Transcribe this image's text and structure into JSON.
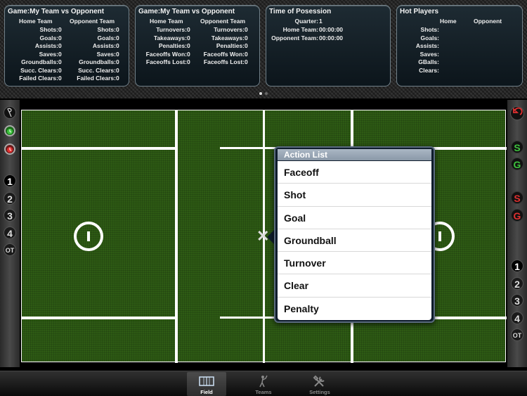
{
  "panels": {
    "game_stats": {
      "title": "Game:My Team vs Opponent",
      "home_header": "Home Team",
      "opp_header": "Opponent Team",
      "rows": [
        {
          "label": "Shots:",
          "home": "0",
          "opp": "0"
        },
        {
          "label": "Goals:",
          "home": "0",
          "opp": "0"
        },
        {
          "label": "Assists:",
          "home": "0",
          "opp": "0"
        },
        {
          "label": "Saves:",
          "home": "0",
          "opp": "0"
        },
        {
          "label": "Groundballs:",
          "home": "0",
          "opp": "0"
        },
        {
          "label": "Succ. Clears:",
          "home": "0",
          "opp": "0"
        },
        {
          "label": "Failed Clears:",
          "home": "0",
          "opp": "0"
        }
      ]
    },
    "game_stats_2": {
      "title": "Game:My Team vs Opponent",
      "home_header": "Home Team",
      "opp_header": "Opponent Team",
      "rows": [
        {
          "label": "Turnovers:",
          "home": "0",
          "opp": "0"
        },
        {
          "label": "Takeaways:",
          "home": "0",
          "opp": "0"
        },
        {
          "label": "Penalties:",
          "home": "0",
          "opp": "0"
        },
        {
          "label": "Faceoffs Won:",
          "home": "0",
          "opp": "0"
        },
        {
          "label": "Faceoffs Lost:",
          "home": "0",
          "opp": "0"
        }
      ]
    },
    "possession": {
      "title": "Time of Posession",
      "rows": [
        {
          "label": "Quarter:",
          "value": "1"
        },
        {
          "label": "Home Team:",
          "value": "00:00:00"
        },
        {
          "label": "Opponent Team:",
          "value": "00:00:00"
        }
      ]
    },
    "hot_players": {
      "title": "Hot Players",
      "home_header": "Home",
      "opp_header": "Opponent",
      "rows": [
        {
          "label": "Shots:"
        },
        {
          "label": "Goals:"
        },
        {
          "label": "Assists:"
        },
        {
          "label": "Saves:"
        },
        {
          "label": "GBalls:"
        },
        {
          "label": "Clears:"
        }
      ]
    }
  },
  "left_bar": {
    "quarters": [
      "1",
      "2",
      "3",
      "4",
      "OT"
    ],
    "selected_quarter": "1"
  },
  "right_bar": {
    "s_label": "S",
    "g_label": "G",
    "quarters": [
      "1",
      "2",
      "3",
      "4",
      "OT"
    ],
    "selected_quarter": "1"
  },
  "popover": {
    "title": "Action List",
    "items": [
      "Faceoff",
      "Shot",
      "Goal",
      "Groundball",
      "Turnover",
      "Clear",
      "Penalty"
    ]
  },
  "tabs": [
    {
      "label": "Field",
      "icon": "field-icon",
      "active": true
    },
    {
      "label": "Teams",
      "icon": "player-icon",
      "active": false
    },
    {
      "label": "Settings",
      "icon": "tools-icon",
      "active": false
    }
  ],
  "colors": {
    "field": "#2e5b14",
    "green_button": "#3ec33e",
    "red_button": "#e03030"
  }
}
